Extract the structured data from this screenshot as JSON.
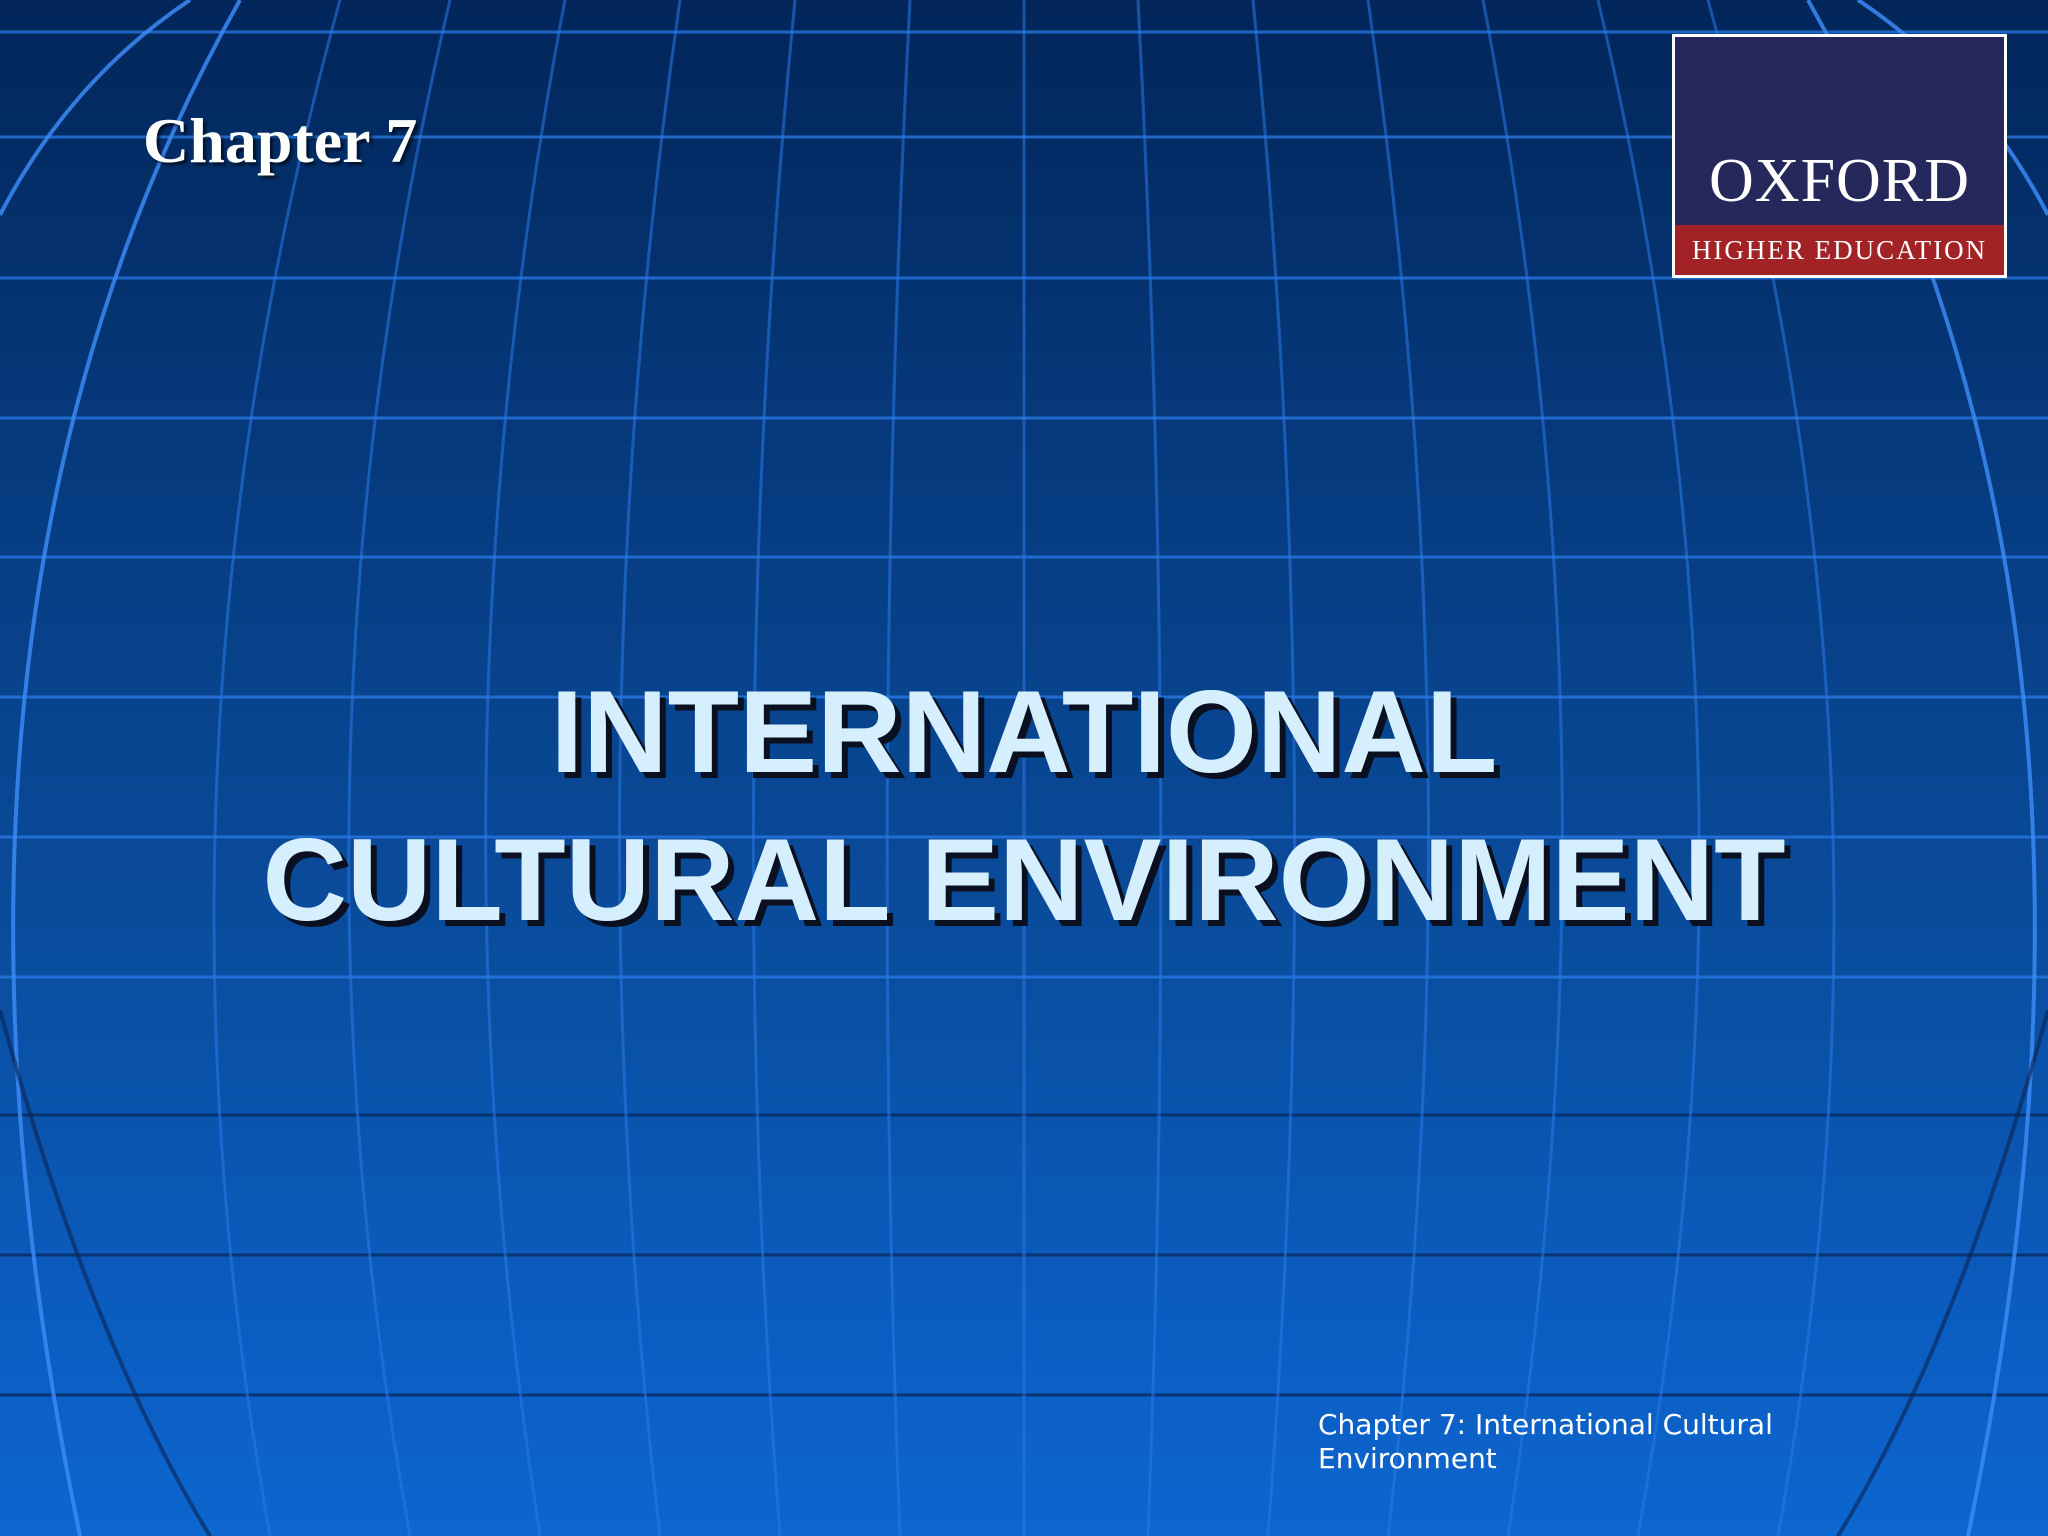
{
  "slide": {
    "chapter_label": "Chapter 7",
    "title_line1": "INTERNATIONAL",
    "title_line2": "CULTURAL ENVIRONMENT",
    "footer": "Chapter 7: International Cultural Environment"
  },
  "logo": {
    "name": "OXFORD",
    "subtitle": "HIGHER EDUCATION",
    "colors": {
      "background": "#24285a",
      "band": "#a32226",
      "border": "#ffffff"
    }
  },
  "theme": {
    "background_top": "#02265a",
    "background_bottom": "#0c66cf",
    "grid_line": "#1f6fe0",
    "title_color": "#d6efff"
  }
}
